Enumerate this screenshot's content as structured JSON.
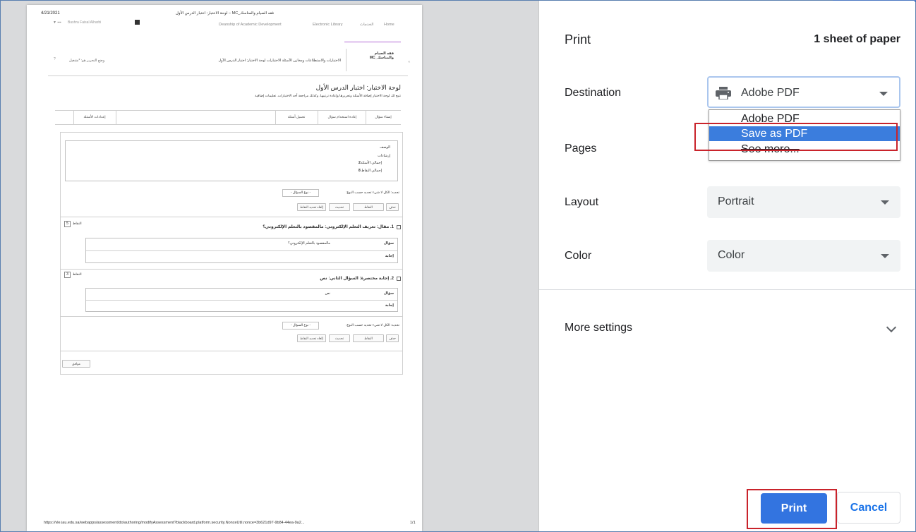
{
  "dialog": {
    "title": "Print",
    "sheet_count": "1 sheet of paper",
    "destination_label": "Destination",
    "destination_value": "Adobe PDF",
    "destination_options": [
      "Adobe PDF",
      "Save as PDF",
      "See more..."
    ],
    "highlighted_option": "Save as PDF",
    "pages_label": "Pages",
    "layout_label": "Layout",
    "layout_value": "Portrait",
    "color_label": "Color",
    "color_value": "Color",
    "more_settings_label": "More settings",
    "print_button": "Print",
    "cancel_button": "Cancel",
    "icons": [
      "printer-icon",
      "dropdown-caret-icon",
      "chevron-down-icon"
    ],
    "colors": {
      "accent": "#3374e0",
      "highlight": "#3b7ddd",
      "annotation": "#c9232b"
    }
  },
  "preview": {
    "date": "4/21/2021",
    "page_title": "فقه الصيام والمناسك_MC – لوحة الاختبار: اختبار الدرس الأول",
    "user_name": "Bushra Faisal Alharbi",
    "nav_links": [
      "Home",
      "الخدمات",
      "Electronic Library",
      "Deanship of Academic Development"
    ],
    "course_name": "فقه الصيام والمناسك_MC",
    "breadcrumb": "الاختبارات والاستطلاعات ومخازن الأسئلة   الاختبارات   لوحة الاختبار: اختبار الدرس الأول",
    "edit_mode": "وضع التحرير هو: *تشغيل",
    "heading": "لوحة الاختبار: اختبار الدرس الأول",
    "subheading": "تتيح لك لوحة الاختبار إضافة الأسئلة وتحريرها وإعادة ترتيبها، وكذلك مراجعة أحد الاختبارات. تعليمات إضافية",
    "toolbar_tabs": [
      "إنشاء سؤال",
      "إعادة استخدام سؤال",
      "تحميل أسئلة",
      "إعدادات الأسئلة"
    ],
    "info_labels": [
      "الوصف",
      "إرشادات",
      "إجمالي الأسئلة",
      "إجمالي النقاط"
    ],
    "total_questions": "2",
    "total_points": "8",
    "filter_label": "تحديد: الكل لا شيء  تحديد حسب النوع:",
    "filter_select": "- نوع السؤال -",
    "action_buttons": [
      "حذف",
      "النقاط",
      "تحديث",
      "إلغاء تحديد النقاط"
    ],
    "points_label": "النقاط",
    "questions": [
      {
        "title": "1. مقال: تعريف التعلم الإلكتروني: مالمقصود بالتعلم الإلكتروني؟",
        "question_label": "سؤال",
        "question_text": "مالمقصود بالتعلم الإلكتروني؟",
        "answer_label": "إجابة",
        "points": "5"
      },
      {
        "title": "2. إجابة مختصرة: السؤال الثاني: نص",
        "question_label": "سؤال",
        "question_text": "نص",
        "answer_label": "إجابة",
        "points": "3"
      }
    ],
    "ok_button": "موافق",
    "footer_url": "https://vle.iau.edu.sa/webapps/assessment/do/authoring/modifyAssessment?blackboard.platform.security.NonceUtil.nonce=3b621d97-9b84-44ea-9a2...",
    "page_count": "1/1"
  }
}
